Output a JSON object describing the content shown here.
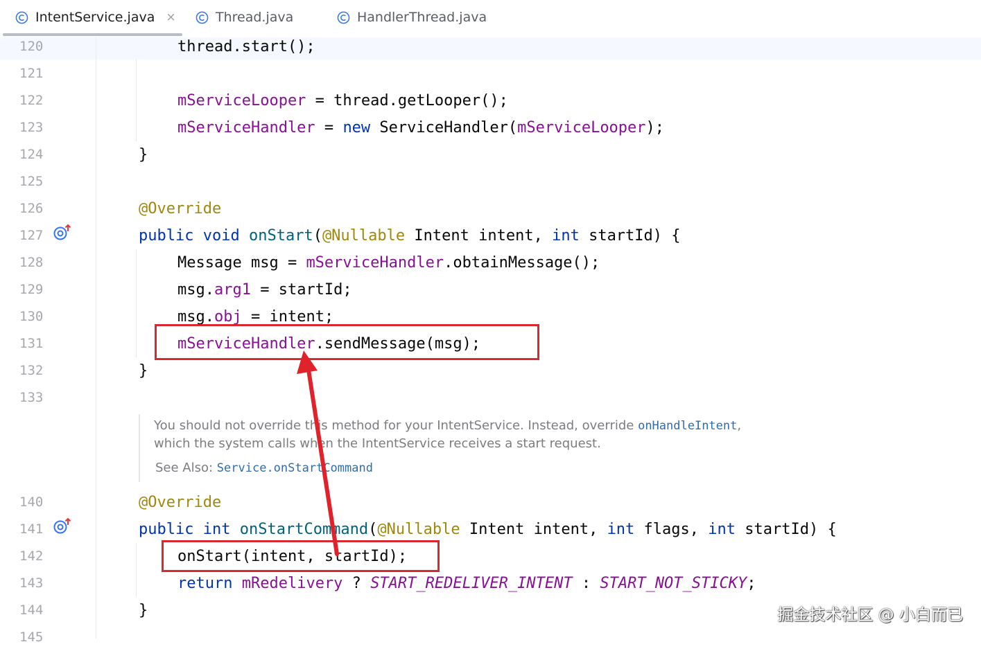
{
  "tabs": [
    {
      "label": "IntentService.java",
      "active": true,
      "close": "×"
    },
    {
      "label": "Thread.java",
      "active": false
    },
    {
      "label": "HandlerThread.java",
      "active": false
    }
  ],
  "line_numbers": [
    "120",
    "121",
    "122",
    "123",
    "124",
    "125",
    "126",
    "127",
    "128",
    "129",
    "130",
    "131",
    "132",
    "133",
    "140",
    "141",
    "142",
    "143",
    "144",
    "145"
  ],
  "code": {
    "l120": {
      "a": "thread.start();"
    },
    "l122": {
      "f": "mServiceLooper",
      "b": " = thread.getLooper();"
    },
    "l123": {
      "f": "mServiceHandler",
      "b": " = ",
      "kw": "new",
      "c": " ServiceHandler(",
      "f2": "mServiceLooper",
      "d": ");"
    },
    "l124": {
      "a": "}"
    },
    "l126": {
      "ann": "@Override"
    },
    "l127": {
      "kw1": "public",
      "s1": " ",
      "kw2": "void",
      "s2": " ",
      "fn": "onStart",
      "p1": "(",
      "ann": "@Nullable",
      "p2": " Intent intent, ",
      "kw3": "int",
      "p3": " startId) {"
    },
    "l128": {
      "a": "Message msg = ",
      "f": "mServiceHandler",
      "b": ".obtainMessage();"
    },
    "l129": {
      "a": "msg.",
      "f": "arg1",
      "b": " = startId;"
    },
    "l130": {
      "a": "msg.",
      "f": "obj",
      "b": " = intent;"
    },
    "l131": {
      "f": "mServiceHandler",
      "b": ".sendMessage(msg);"
    },
    "l132": {
      "a": "}"
    },
    "l140": {
      "ann": "@Override"
    },
    "l141": {
      "kw1": "public",
      "s1": " ",
      "kw2": "int",
      "s2": " ",
      "fn": "onStartCommand",
      "p1": "(",
      "ann": "@Nullable",
      "p2": " Intent intent, ",
      "kw3": "int",
      "p3": " flags, ",
      "kw4": "int",
      "p4": " startId) {"
    },
    "l142": {
      "a": "onStart(intent, startId);"
    },
    "l143": {
      "kw": "return",
      "s": " ",
      "f": "mRedelivery",
      "b": " ? ",
      "c1": "START_REDELIVER_INTENT",
      "m": " : ",
      "c2": "START_NOT_STICKY",
      "e": ";"
    },
    "l144": {
      "a": "}"
    }
  },
  "doc": {
    "line1_a": "You should not override this method for your IntentService. Instead, override ",
    "line1_code": "onHandleIntent",
    "line1_b": ",",
    "line2": "which the system calls when the IntentService receives a start request.",
    "line3_label": "See Also: ",
    "line3_code": "Service.onStartCommand"
  },
  "watermark": "掘金技术社区 @ 小白而已",
  "colors": {
    "highlight": "#d9282f",
    "keyword": "#0033b3",
    "field": "#871094",
    "annotation": "#9e880d"
  }
}
